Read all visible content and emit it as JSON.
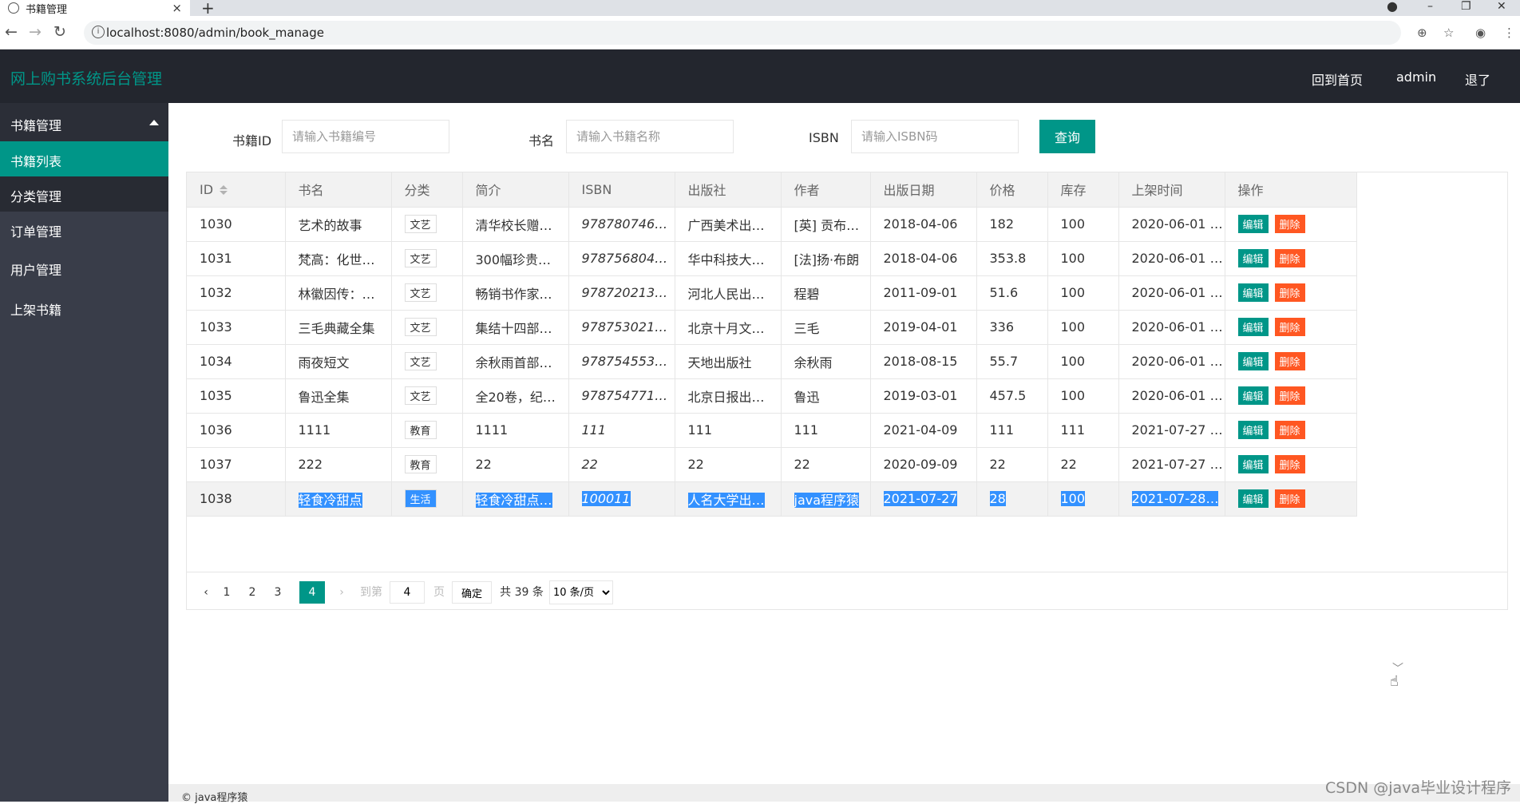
{
  "browser": {
    "tab_title": "书籍管理",
    "tab_close": "×",
    "new_tab": "+",
    "url": "localhost:8080/admin/book_manage",
    "win_min": "–",
    "win_max": "❐",
    "win_close": "✕"
  },
  "header": {
    "logo": "网上购书系统后台管理",
    "links": [
      "回到首页",
      "admin",
      "退了"
    ]
  },
  "sidebar": {
    "group": "书籍管理",
    "sub_items": [
      "书籍列表",
      "分类管理"
    ],
    "items": [
      "订单管理",
      "用户管理",
      "上架书籍"
    ]
  },
  "search": {
    "id_label": "书籍ID",
    "id_placeholder": "请输入书籍编号",
    "name_label": "书名",
    "name_placeholder": "请输入书籍名称",
    "isbn_label": "ISBN",
    "isbn_placeholder": "请输入ISBN码",
    "button": "查询"
  },
  "table": {
    "columns": [
      "ID",
      "书名",
      "分类",
      "简介",
      "ISBN",
      "出版社",
      "作者",
      "出版日期",
      "价格",
      "库存",
      "上架时间",
      "操作"
    ],
    "edit_label": "编辑",
    "delete_label": "删除",
    "rows": [
      {
        "id": "1030",
        "name": "艺术的故事",
        "cat": "文艺",
        "intro": "清华校长赠…",
        "isbn": "978780746…",
        "pub": "广西美术出…",
        "author": "[英] 贡布…",
        "date": "2018-04-06",
        "price": "182",
        "stock": "100",
        "time": "2020-06-01 …"
      },
      {
        "id": "1031",
        "name": "梵高：化世…",
        "cat": "文艺",
        "intro": "300幅珍贵…",
        "isbn": "978756804…",
        "pub": "华中科技大…",
        "author": "[法]扬·布朗",
        "date": "2018-04-06",
        "price": "353.8",
        "stock": "100",
        "time": "2020-06-01 …"
      },
      {
        "id": "1032",
        "name": "林徽因传：…",
        "cat": "文艺",
        "intro": "畅销书作家…",
        "isbn": "978720213…",
        "pub": "河北人民出…",
        "author": "程碧",
        "date": "2011-09-01",
        "price": "51.6",
        "stock": "100",
        "time": "2020-06-01 …"
      },
      {
        "id": "1033",
        "name": "三毛典藏全集",
        "cat": "文艺",
        "intro": "集结十四部…",
        "isbn": "978753021…",
        "pub": "北京十月文…",
        "author": "三毛",
        "date": "2019-04-01",
        "price": "336",
        "stock": "100",
        "time": "2020-06-01 …"
      },
      {
        "id": "1034",
        "name": "雨夜短文",
        "cat": "文艺",
        "intro": "余秋雨首部…",
        "isbn": "978754553…",
        "pub": "天地出版社",
        "author": "余秋雨",
        "date": "2018-08-15",
        "price": "55.7",
        "stock": "100",
        "time": "2020-06-01 …"
      },
      {
        "id": "1035",
        "name": "鲁迅全集",
        "cat": "文艺",
        "intro": "全20卷，纪…",
        "isbn": "9787547711…",
        "pub": "北京日报出…",
        "author": "鲁迅",
        "date": "2019-03-01",
        "price": "457.5",
        "stock": "100",
        "time": "2020-06-01 …"
      },
      {
        "id": "1036",
        "name": "1111",
        "cat": "教育",
        "intro": "1111",
        "isbn": "111",
        "pub": "111",
        "author": "111",
        "date": "2021-04-09",
        "price": "111",
        "stock": "111",
        "time": "2021-07-27 …"
      },
      {
        "id": "1037",
        "name": "222",
        "cat": "教育",
        "intro": "22",
        "isbn": "22",
        "pub": "22",
        "author": "22",
        "date": "2020-09-09",
        "price": "22",
        "stock": "22",
        "time": "2021-07-27 …"
      },
      {
        "id": "1038",
        "name": "轻食冷甜点",
        "cat": "生活",
        "intro": "轻食冷甜点…",
        "isbn": "100011",
        "pub": "人名大学出…",
        "author": "java程序猿",
        "date": "2021-07-27",
        "price": "28",
        "stock": "100",
        "time": "2021-07-28…"
      }
    ]
  },
  "pager": {
    "pages": [
      "1",
      "2",
      "3",
      "4"
    ],
    "current": "4",
    "goto_label": "到第",
    "goto_value": "4",
    "page_unit": "页",
    "ok": "确定",
    "total": "共 39 条",
    "size": "10 条/页"
  },
  "footer": "© java程序猿",
  "watermark": "CSDN @java毕业设计程序"
}
